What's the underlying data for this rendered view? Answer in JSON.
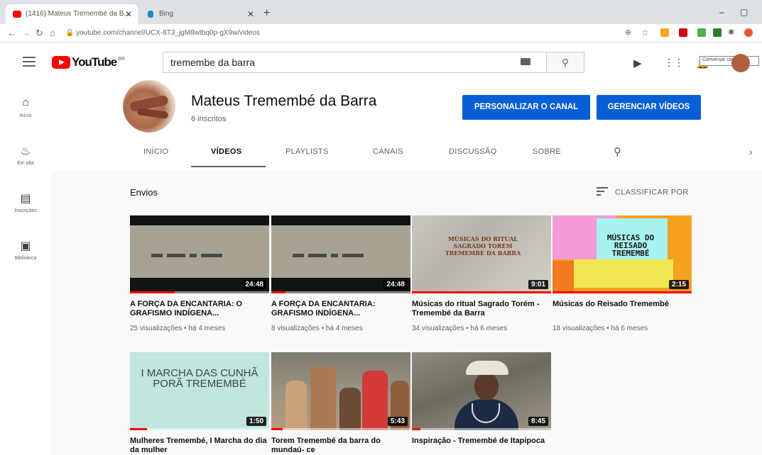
{
  "browser": {
    "tabs": [
      {
        "title": "(1416) Mateus Tremembé da B...",
        "active": true
      },
      {
        "title": "Bing",
        "active": false
      }
    ],
    "url": "youtube.com/channel/UCX-8T3_jgM8wtbq0p-gX9w/videos"
  },
  "youtube": {
    "search_query": "tremembe da barra",
    "tooltip": "Conversar com a G...",
    "guide": [
      {
        "label": "Início",
        "icon": "home-icon"
      },
      {
        "label": "Em alta",
        "icon": "fire-icon"
      },
      {
        "label": "Inscrições",
        "icon": "subscriptions-icon"
      },
      {
        "label": "Biblioteca",
        "icon": "library-icon"
      }
    ]
  },
  "channel": {
    "name": "Mateus Tremembé da Barra",
    "subscribers": "6 inscritos",
    "btn_customize": "PERSONALIZAR O CANAL",
    "btn_manage": "GERENCIAR VÍDEOS",
    "tabs": [
      "INÍCIO",
      "VÍDEOS",
      "PLAYLISTS",
      "CANAIS",
      "DISCUSSÃO",
      "SOBRE"
    ]
  },
  "section": {
    "title": "Envios",
    "sort": "CLASSIFICAR POR"
  },
  "videos": [
    {
      "title": "A FORÇA DA ENCANTARIA: O GRAFISMO INDÍGENA...",
      "meta": "25 visualizações • há 4 meses",
      "duration": "24:48",
      "progress": 0.32
    },
    {
      "title": "A FORÇA DA ENCANTARIA: GRAFISMO INDÍGENA...",
      "meta": "8 visualizações • há 4 meses",
      "duration": "24:48",
      "progress": 0.1
    },
    {
      "title": "Músicas do ritual Sagrado Torém - Tremembé da Barra",
      "meta": "34 visualizações • há 6 meses",
      "duration": "9:01",
      "progress": 1.0,
      "thumb_text": "MÚSICAS DO RITUAL SAGRADO TORÉM TREMEMBÉ DA BARRA"
    },
    {
      "title": "Músicas do Reisado Tremembé",
      "meta": "18 visualizações • há 6 meses",
      "duration": "2:15",
      "progress": 1.0,
      "thumb_text": "MÚSICAS DO REISADO TREMEMBÉ"
    },
    {
      "title": "Mulheres Tremembé, I Marcha do dia da mulher",
      "meta": "",
      "duration": "1:50",
      "progress": 0.12,
      "thumb_text": "I MARCHA DAS CUNHÃ PORÃ TREMEMBÉ"
    },
    {
      "title": "Torem Tremembé da barra do mundaú- ce",
      "meta": "",
      "duration": "5:43",
      "progress": 0.08
    },
    {
      "title": "Inspiração - Tremembé de Itapipoca",
      "meta": "",
      "duration": "8:45",
      "progress": 0.06
    }
  ]
}
